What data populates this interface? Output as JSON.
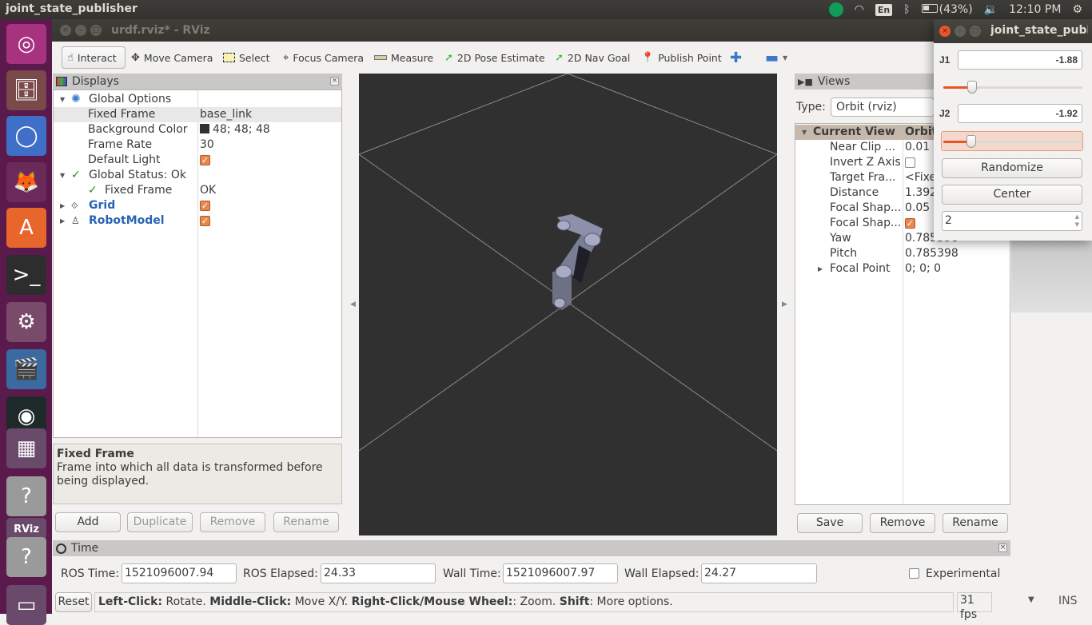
{
  "top_panel": {
    "app_title": "joint_state_publisher",
    "keyboard": "En",
    "battery": "(43%)",
    "clock": "12:10 PM"
  },
  "launcher": {
    "items": [
      {
        "name": "ubuntu-dash",
        "glyph": "◎",
        "bg": "#a7327f"
      },
      {
        "name": "files",
        "glyph": "🗄",
        "bg": "#7a4a4a"
      },
      {
        "name": "chromium",
        "glyph": "◯",
        "bg": "#3f6fc7"
      },
      {
        "name": "firefox",
        "glyph": "🦊",
        "bg": "#6a2a5a"
      },
      {
        "name": "software-center",
        "glyph": "A",
        "bg": "#e8652c"
      },
      {
        "name": "terminal",
        "glyph": ">_",
        "bg": "#2d2d2d"
      },
      {
        "name": "system-settings",
        "glyph": "⚙",
        "bg": "#7a4a6a"
      },
      {
        "name": "media-app",
        "glyph": "🎬",
        "bg": "#3b6aa0"
      },
      {
        "name": "camera-app",
        "glyph": "◉",
        "bg": "#1e2a2a"
      },
      {
        "name": "sudoku-game",
        "glyph": "▦",
        "bg": "#6a4a6a"
      },
      {
        "name": "unknown-app",
        "glyph": "?",
        "bg": "#9a9a9a"
      },
      {
        "name": "rviz",
        "glyph": "RViz",
        "bg": "#6a4a6a"
      },
      {
        "name": "unknown-app-2",
        "glyph": "?",
        "bg": "#9a9a9a"
      },
      {
        "name": "drive",
        "glyph": "▭",
        "bg": "#6a4a6a"
      }
    ]
  },
  "rviz": {
    "title": "urdf.rviz* - RViz",
    "toolbar": [
      {
        "label": "Interact",
        "icon": "hand-icon",
        "active": true
      },
      {
        "label": "Move Camera",
        "icon": "move-camera-icon"
      },
      {
        "label": "Select",
        "icon": "select-icon"
      },
      {
        "label": "Focus Camera",
        "icon": "focus-camera-icon"
      },
      {
        "label": "Measure",
        "icon": "ruler-icon"
      },
      {
        "label": "2D Pose Estimate",
        "icon": "green-arrow-icon"
      },
      {
        "label": "2D Nav Goal",
        "icon": "green-arrow-icon"
      },
      {
        "label": "Publish Point",
        "icon": "pin-icon"
      }
    ],
    "displays": {
      "title": "Displays",
      "rows": [
        {
          "key": "Global Options",
          "value": ""
        },
        {
          "key": "Fixed Frame",
          "value": "base_link"
        },
        {
          "key": "Background Color",
          "value": "48; 48; 48"
        },
        {
          "key": "Frame Rate",
          "value": "30"
        },
        {
          "key": "Default Light",
          "value": ""
        },
        {
          "key": "Global Status: Ok",
          "value": ""
        },
        {
          "key": "Fixed Frame",
          "value": "OK"
        },
        {
          "key": "Grid",
          "value": ""
        },
        {
          "key": "RobotModel",
          "value": ""
        }
      ],
      "description_title": "Fixed Frame",
      "description_text": "Frame into which all data is transformed before being displayed.",
      "buttons": {
        "add": "Add",
        "duplicate": "Duplicate",
        "remove": "Remove",
        "rename": "Rename"
      }
    },
    "views": {
      "title": "Views",
      "type_label": "Type:",
      "type_value": "Orbit (rviz)",
      "header_key": "Current View",
      "header_value": "Orbit",
      "rows": [
        {
          "key": "Near Clip ...",
          "value": "0.01"
        },
        {
          "key": "Invert Z Axis",
          "value": ""
        },
        {
          "key": "Target Fra...",
          "value": "<Fixe"
        },
        {
          "key": "Distance",
          "value": "1.392"
        },
        {
          "key": "Focal Shap...",
          "value": "0.05"
        },
        {
          "key": "Focal Shap...",
          "value": ""
        },
        {
          "key": "Yaw",
          "value": "0.785398"
        },
        {
          "key": "Pitch",
          "value": "0.785398"
        },
        {
          "key": "Focal Point",
          "value": "0; 0; 0"
        }
      ],
      "buttons": {
        "save": "Save",
        "remove": "Remove",
        "rename": "Rename"
      }
    },
    "time": {
      "title": "Time",
      "ros_time_label": "ROS Time:",
      "ros_time": "1521096007.94",
      "ros_elapsed_label": "ROS Elapsed:",
      "ros_elapsed": "24.33",
      "wall_time_label": "Wall Time:",
      "wall_time": "1521096007.97",
      "wall_elapsed_label": "Wall Elapsed:",
      "wall_elapsed": "24.27",
      "experimental": "Experimental"
    },
    "status": {
      "reset": "Reset",
      "b1": "Left-Click:",
      "t1": " Rotate. ",
      "b2": "Middle-Click:",
      "t2": " Move X/Y. ",
      "b3": "Right-Click/Mouse Wheel:",
      "t3": ": Zoom. ",
      "b4": "Shift",
      "t4": ": More options.",
      "fps": "31 fps"
    }
  },
  "joint_state_publisher": {
    "title": "joint_state_publ",
    "joints": [
      {
        "label": "J1",
        "value": "-1.88",
        "slider_fraction": 0.2
      },
      {
        "label": "J2",
        "value": "-1.92",
        "slider_fraction": 0.19
      }
    ],
    "randomize": "Randomize",
    "center": "Center",
    "spin_value": "2"
  },
  "editor_status": {
    "mode": "INS"
  },
  "colors": {
    "accent": "#e95420",
    "viewport_bg": "#303030",
    "link_blue": "#2a64b5",
    "check_orange": "#e7884d"
  }
}
